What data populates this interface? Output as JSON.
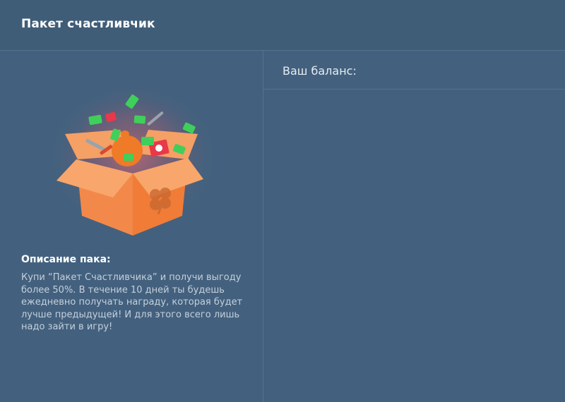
{
  "header": {
    "title": "Пакет счастливчик"
  },
  "pack": {
    "image_name": "lucky-pack-box",
    "description_title": "Описание пака:",
    "description_text": "Купи “Пакет Счастливчика” и получи выгоду более 50%. В течение 10 дней ты будешь ежедневно получать награду, которая будет лучше предыдущей! И для этого всего лишь надо зайти в игру!"
  },
  "balance": {
    "label": "Ваш баланс:"
  },
  "colors": {
    "background": "#43617e",
    "header_bg": "#405d78",
    "divider": "#56718b",
    "box_orange": "#f2894a",
    "money_green": "#3fcf5a"
  }
}
